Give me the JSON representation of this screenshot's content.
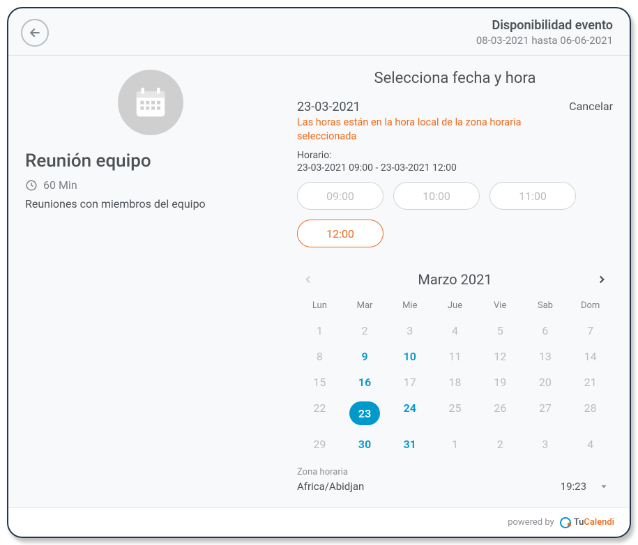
{
  "header": {
    "title": "Disponibilidad evento",
    "range": "08-03-2021 hasta 06-06-2021"
  },
  "left": {
    "event_name": "Reunión equipo",
    "duration": "60 Min",
    "description": "Reuniones con miembros del equipo"
  },
  "right": {
    "title": "Selecciona fecha y hora",
    "selected_date": "23-03-2021",
    "cancel": "Cancelar",
    "tz_note": "Las horas están en la hora local de la zona horaria seleccionada",
    "schedule_label": "Horario:",
    "schedule_range": "23-03-2021 09:00 - 23-03-2021 12:00",
    "slots": [
      {
        "label": "09:00",
        "active": false
      },
      {
        "label": "10:00",
        "active": false
      },
      {
        "label": "11:00",
        "active": false
      },
      {
        "label": "12:00",
        "active": true
      }
    ],
    "month_label": "Marzo 2021",
    "weekdays": [
      "Lun",
      "Mar",
      "Mie",
      "Jue",
      "Vie",
      "Sab",
      "Dom"
    ],
    "days": [
      [
        {
          "n": "1"
        },
        {
          "n": "2"
        },
        {
          "n": "3"
        },
        {
          "n": "4"
        },
        {
          "n": "5"
        },
        {
          "n": "6"
        },
        {
          "n": "7"
        }
      ],
      [
        {
          "n": "8"
        },
        {
          "n": "9",
          "avail": true
        },
        {
          "n": "10",
          "avail": true
        },
        {
          "n": "11"
        },
        {
          "n": "12"
        },
        {
          "n": "13"
        },
        {
          "n": "14"
        }
      ],
      [
        {
          "n": "15"
        },
        {
          "n": "16",
          "avail": true
        },
        {
          "n": "17"
        },
        {
          "n": "18"
        },
        {
          "n": "19"
        },
        {
          "n": "20"
        },
        {
          "n": "21"
        }
      ],
      [
        {
          "n": "22"
        },
        {
          "n": "23",
          "avail": true,
          "selected": true
        },
        {
          "n": "24",
          "avail": true
        },
        {
          "n": "25"
        },
        {
          "n": "26"
        },
        {
          "n": "27"
        },
        {
          "n": "28"
        }
      ],
      [
        {
          "n": "29"
        },
        {
          "n": "30",
          "avail": true
        },
        {
          "n": "31",
          "avail": true
        },
        {
          "n": "1"
        },
        {
          "n": "2"
        },
        {
          "n": "3"
        },
        {
          "n": "4"
        }
      ]
    ],
    "tz_label": "Zona horaria",
    "tz_value": "Africa/Abidjan",
    "tz_time": "19:23"
  },
  "footer": {
    "powered_by": "powered by",
    "brand_tu": "Tu",
    "brand_cal": "Calendi"
  }
}
